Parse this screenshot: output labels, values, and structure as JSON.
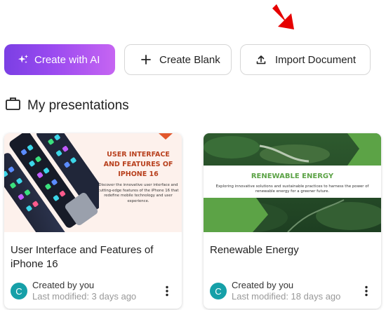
{
  "toolbar": {
    "create_ai_label": "Create with AI",
    "create_blank_label": "Create Blank",
    "import_label": "Import Document"
  },
  "section": {
    "title": "My presentations"
  },
  "presentations": [
    {
      "title": "User Interface and Features of iPhone 16",
      "thumb_title": "USER INTERFACE AND FEATURES OF IPHONE 16",
      "thumb_desc": "Discover the innovative user interface and cutting-edge features of the iPhone 16 that redefine mobile technology and user experience.",
      "avatar_initial": "C",
      "created_by": "Created by you",
      "last_modified": "Last modified: 3 days ago"
    },
    {
      "title": "Renewable Energy",
      "thumb_title": "RENEWABLE ENERGY",
      "thumb_desc": "Exploring innovative solutions and sustainable practices to harness the power of renewable energy for a greener future.",
      "avatar_initial": "C",
      "created_by": "Created by you",
      "last_modified": "Last modified: 18 days ago"
    }
  ],
  "colors": {
    "ai_gradient_start": "#7b3fe4",
    "ai_gradient_end": "#c665f2",
    "avatar": "#16a0a8",
    "annotation_arrow": "#e60000",
    "thumb1_accent": "#b8401d",
    "thumb2_accent": "#5ca346"
  },
  "icons": {
    "ai": "sparkles-icon",
    "blank": "plus-icon",
    "import": "upload-icon",
    "section": "briefcase-icon",
    "more": "more-vertical-icon"
  }
}
